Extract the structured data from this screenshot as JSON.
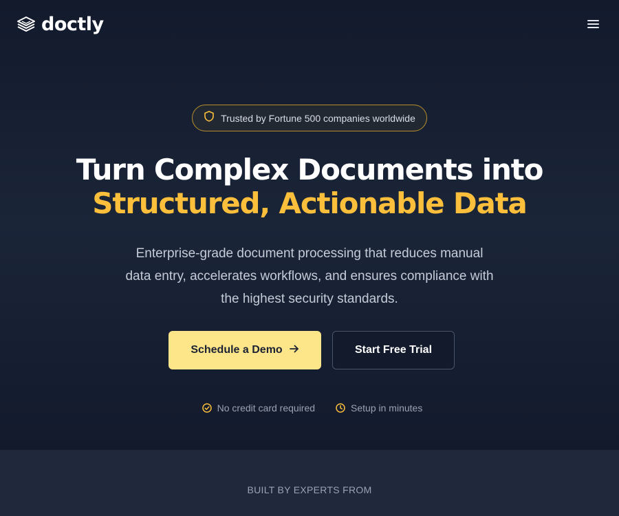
{
  "header": {
    "logo_text": "doctly",
    "logo_icon": "stacked-layers-icon",
    "menu_icon": "hamburger-menu-icon"
  },
  "hero": {
    "badge": {
      "icon": "shield-icon",
      "text": "Trusted by Fortune 500 companies worldwide"
    },
    "headline_line1": "Turn Complex Documents into",
    "headline_line2": "Structured, Actionable Data",
    "subtext": "Enterprise-grade document processing that reduces manual data entry, accelerates workflows, and ensures compliance with the highest security standards.",
    "primary_cta": {
      "label": "Schedule a Demo",
      "icon": "arrow-right-icon"
    },
    "secondary_cta": {
      "label": "Start Free Trial"
    },
    "notes": [
      {
        "icon": "check-circle-icon",
        "text": "No credit card required"
      },
      {
        "icon": "clock-icon",
        "text": "Setup in minutes"
      }
    ]
  },
  "experts_section": {
    "heading": "BUILT BY EXPERTS FROM"
  },
  "colors": {
    "background": "#121a2b",
    "accent": "#fbbf3c",
    "primary_button": "#fde58a",
    "lower_section": "#1f293b"
  }
}
